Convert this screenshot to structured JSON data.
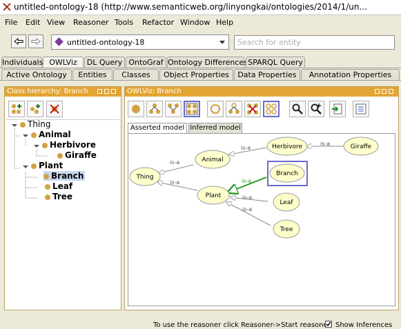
{
  "window": {
    "title": "untitled-ontology-18 (http://www.semanticweb.org/linyongkai/ontologies/2014/1/un..."
  },
  "menu": [
    "File",
    "Edit",
    "View",
    "Reasoner",
    "Tools",
    "Refactor",
    "Window",
    "Help"
  ],
  "toolbar": {
    "ontology_selected": "untitled-ontology-18",
    "search_placeholder": "Search for entity"
  },
  "tabs_row1": [
    "Individuals",
    "OWLViz",
    "DL Query",
    "OntoGraf",
    "Ontology Differences",
    "SPARQL Query"
  ],
  "tabs_row2": [
    "Active Ontology",
    "Entities",
    "Classes",
    "Object Properties",
    "Data Properties",
    "Annotation Properties"
  ],
  "left_panel": {
    "title": "Class hierarchy: Branch",
    "tree": [
      {
        "label": "Thing"
      },
      {
        "label": "Animal"
      },
      {
        "label": "Herbivore"
      },
      {
        "label": "Giraffe"
      },
      {
        "label": "Plant"
      },
      {
        "label": "Branch"
      },
      {
        "label": "Leaf"
      },
      {
        "label": "Tree"
      }
    ]
  },
  "right_panel": {
    "title": "OWLViz: Branch",
    "subtabs": [
      "Asserted model",
      "Inferred model"
    ],
    "graph": {
      "nodes": [
        "Thing",
        "Animal",
        "Herbivore",
        "Giraffe",
        "Plant",
        "Branch",
        "Leaf",
        "Tree"
      ],
      "edge_label": "is-a"
    }
  },
  "status": {
    "message": "To use the reasoner click Reasoner->Start reasoner",
    "show_inferences": "Show Inferences"
  },
  "colors": {
    "panel_header": "#e3a533",
    "node_fill": "#ffffcc",
    "selected_edge": "#2a9a2a",
    "selected_box": "#6a6acc"
  }
}
